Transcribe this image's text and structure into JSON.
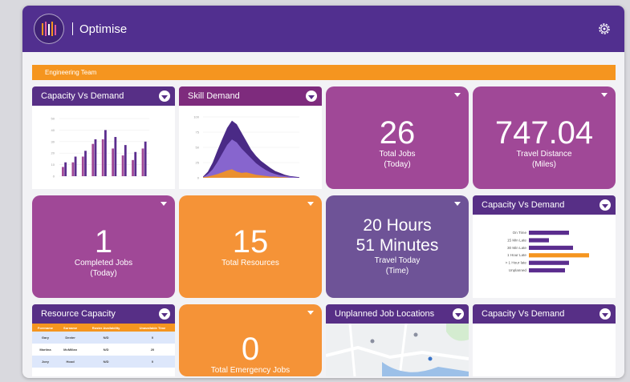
{
  "header": {
    "title": "Optimise",
    "logo_icon": "optimise-logo-icon",
    "settings_icon": "gear-icon"
  },
  "team_bar": {
    "label": "Engineering Team"
  },
  "tiles": {
    "capacity_demand_1": {
      "title": "Capacity Vs Demand"
    },
    "skill_demand": {
      "title": "Skill Demand"
    },
    "total_jobs": {
      "value": "26",
      "label1": "Total Jobs",
      "label2": "(Today)"
    },
    "travel_distance": {
      "value": "747.04",
      "label1": "Travel Distance",
      "label2": "(Miles)"
    },
    "completed_jobs": {
      "value": "1",
      "label1": "Completed Jobs",
      "label2": "(Today)"
    },
    "total_resources": {
      "value": "15",
      "label1": "Total Resources"
    },
    "travel_time": {
      "line1": "20 Hours",
      "line2": "51 Minutes",
      "label1": "Travel Today",
      "label2": "(Time)"
    },
    "capacity_demand_2": {
      "title": "Capacity Vs Demand"
    },
    "resource_capacity": {
      "title": "Resource Capacity",
      "columns": [
        "Forename",
        "Surname",
        "Roster Availability",
        "Unavailable Time"
      ],
      "rows": [
        [
          "Gary",
          "Dexter",
          "N/D",
          "0"
        ],
        [
          "Martina",
          "McMillan",
          "N/D",
          "20"
        ],
        [
          "Joey",
          "Hood",
          "N/D",
          "0"
        ]
      ]
    },
    "emergency_jobs": {
      "value": "0",
      "label1": "Total Emergency Jobs"
    },
    "unplanned_locations": {
      "title": "Unplanned Job Locations"
    },
    "capacity_demand_3": {
      "title": "Capacity Vs Demand"
    }
  },
  "colors": {
    "header": "#512f8f",
    "accent_orange": "#f5951f",
    "plum": "#a04897",
    "violet": "#6e5397",
    "bar_purple": "#5b2d8e"
  },
  "chart_data": [
    {
      "type": "bar",
      "tile": "Capacity Vs Demand",
      "categories": [
        "1",
        "2",
        "3",
        "4",
        "5",
        "6",
        "7",
        "8",
        "9"
      ],
      "series": [
        {
          "values": [
            8,
            12,
            17,
            28,
            32,
            24,
            18,
            14,
            24
          ]
        },
        {
          "values": [
            12,
            17,
            22,
            32,
            40,
            34,
            27,
            21,
            30
          ]
        }
      ],
      "yticks": [
        "50",
        "40",
        "30",
        "20",
        "10",
        "0"
      ],
      "ylim": [
        0,
        50
      ]
    },
    {
      "type": "area",
      "tile": "Skill Demand",
      "x": [
        0,
        1,
        2,
        3,
        4,
        5,
        6,
        7,
        8,
        9,
        10,
        11,
        12,
        13,
        14,
        15,
        16,
        17,
        18,
        19,
        20
      ],
      "series": [
        {
          "values": [
            2,
            10,
            25,
            45,
            64,
            82,
            94,
            88,
            74,
            60,
            46,
            36,
            28,
            22,
            16,
            11,
            8,
            5,
            3,
            2,
            1
          ]
        },
        {
          "values": [
            1,
            6,
            14,
            26,
            40,
            54,
            63,
            58,
            48,
            40,
            32,
            24,
            18,
            13,
            9,
            6,
            4,
            3,
            2,
            1,
            0
          ]
        },
        {
          "values": [
            1,
            2,
            4,
            6,
            9,
            12,
            14,
            10,
            8,
            9,
            7,
            5,
            4,
            3,
            2,
            2,
            1,
            1,
            0,
            0,
            0
          ]
        }
      ],
      "yticks": [
        "100",
        "75",
        "50",
        "25",
        "0"
      ],
      "ylim": [
        0,
        100
      ]
    },
    {
      "type": "bar",
      "orientation": "horizontal",
      "tile": "Capacity Vs Demand",
      "categories": [
        "On Time",
        "15 Min Late",
        "30 Min Late",
        "1 Hour Late",
        "> 1 Hour late",
        "Unplanned"
      ],
      "values": [
        10,
        5,
        11,
        15,
        10,
        9
      ],
      "highlight_category": "1 Hour Late",
      "xlim": [
        0,
        16
      ]
    }
  ]
}
